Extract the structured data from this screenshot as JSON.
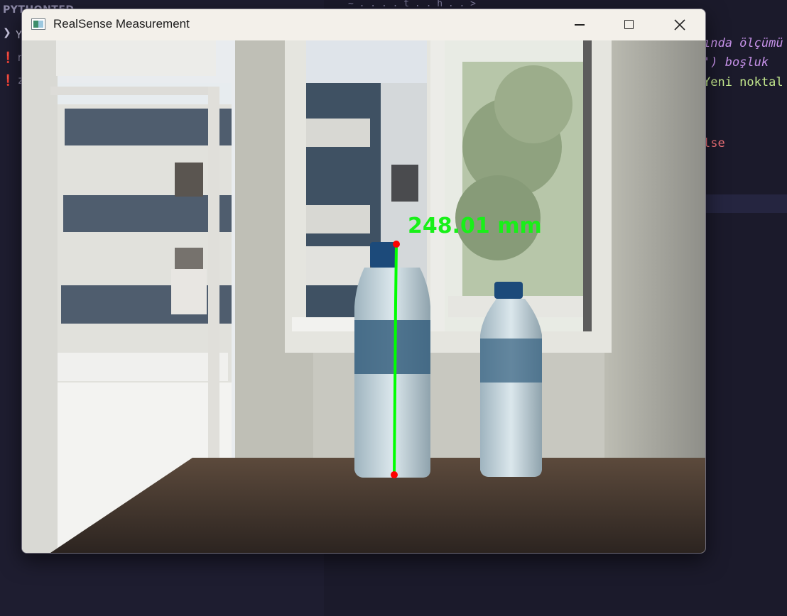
{
  "background_editor": {
    "explorer_header": "PYTHONTED",
    "explorer_rows": [
      "Y",
      "n",
      "z"
    ],
    "tab_fragment": "~ . . . . t . . h . . >",
    "code_lines": [
      {
        "text": "ında ölçümü",
        "kind": "purple"
      },
      {
        "text": "') boşluk",
        "kind": "purple"
      },
      {
        "text": "Yeni noktal",
        "kind": "green"
      },
      {
        "text": "lse",
        "kind": "pink"
      }
    ]
  },
  "window": {
    "title": "RealSense Measurement",
    "app_icon": "opencv-window-icon",
    "controls": {
      "minimize": "minimize-icon",
      "maximize": "maximize-icon",
      "close": "close-icon"
    }
  },
  "measurement": {
    "value_text": "248.01 mm",
    "line_color": "#00ff00",
    "point_color": "#ff0000"
  }
}
